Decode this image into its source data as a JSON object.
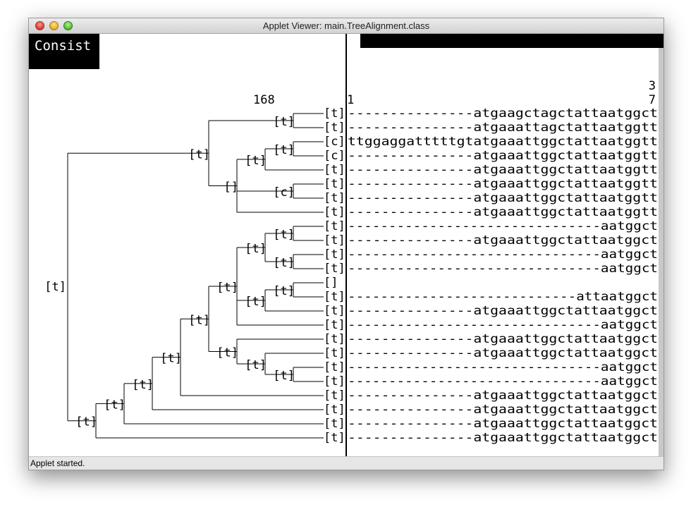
{
  "window": {
    "title": "Applet Viewer: main.TreeAlignment.class",
    "status": "Applet started."
  },
  "panel": {
    "label": "Consist",
    "tree_header": "168",
    "seq_start": "1",
    "seq_end_top": "3",
    "seq_end_bottom": "7"
  },
  "rows": [
    {
      "tag": "[t]",
      "seq": "---------------atgaagctagctattaatggct"
    },
    {
      "tag": "[t]",
      "seq": "---------------atgaaattagctattaatggtt"
    },
    {
      "tag": "[c]",
      "seq": "ttggaggatttttgtatgaaattggctattaatggtt"
    },
    {
      "tag": "[c]",
      "seq": "---------------atgaaattggctattaatggtt"
    },
    {
      "tag": "[t]",
      "seq": "---------------atgaaattggctattaatggtt"
    },
    {
      "tag": "[t]",
      "seq": "---------------atgaaattggctattaatggtt"
    },
    {
      "tag": "[t]",
      "seq": "---------------atgaaattggctattaatggtt"
    },
    {
      "tag": "[t]",
      "seq": "---------------atgaaattggctattaatggtt"
    },
    {
      "tag": "[t]",
      "seq": "-------------------------------aatggct"
    },
    {
      "tag": "[t]",
      "seq": "---------------atgaaattggctattaatggct"
    },
    {
      "tag": "[t]",
      "seq": "-------------------------------aatggct"
    },
    {
      "tag": "[t]",
      "seq": "-------------------------------aatggct"
    },
    {
      "tag": "[]",
      "seq": ""
    },
    {
      "tag": "[t]",
      "seq": "----------------------------attaatggct"
    },
    {
      "tag": "[t]",
      "seq": "---------------atgaaattggctattaatggct"
    },
    {
      "tag": "[t]",
      "seq": "-------------------------------aatggct"
    },
    {
      "tag": "[t]",
      "seq": "---------------atgaaattggctattaatggct"
    },
    {
      "tag": "[t]",
      "seq": "---------------atgaaattggctattaatggct"
    },
    {
      "tag": "[t]",
      "seq": "-------------------------------aatggct"
    },
    {
      "tag": "[t]",
      "seq": "-------------------------------aatggct"
    },
    {
      "tag": "[t]",
      "seq": "---------------atgaaattggctattaatggct"
    },
    {
      "tag": "[t]",
      "seq": "---------------atgaaattggctattaatggct"
    },
    {
      "tag": "[t]",
      "seq": "---------------atgaaattggctattaatggct"
    },
    {
      "tag": "[t]",
      "seq": "---------------atgaaattggctattaatggct"
    }
  ],
  "tree": {
    "root_label": "[t]",
    "node_labels": [
      "[t]",
      "[t]",
      "[t]",
      "[c]",
      "[]",
      "[t]",
      "[t]",
      "[t]",
      "[t]",
      "[t]",
      "[t]",
      "[t]",
      "[t]",
      "[t]",
      "[t]",
      "[t]",
      "[t]",
      "[t]",
      "[t]",
      "[t]",
      "[t]",
      "[t]",
      "[t]"
    ]
  }
}
